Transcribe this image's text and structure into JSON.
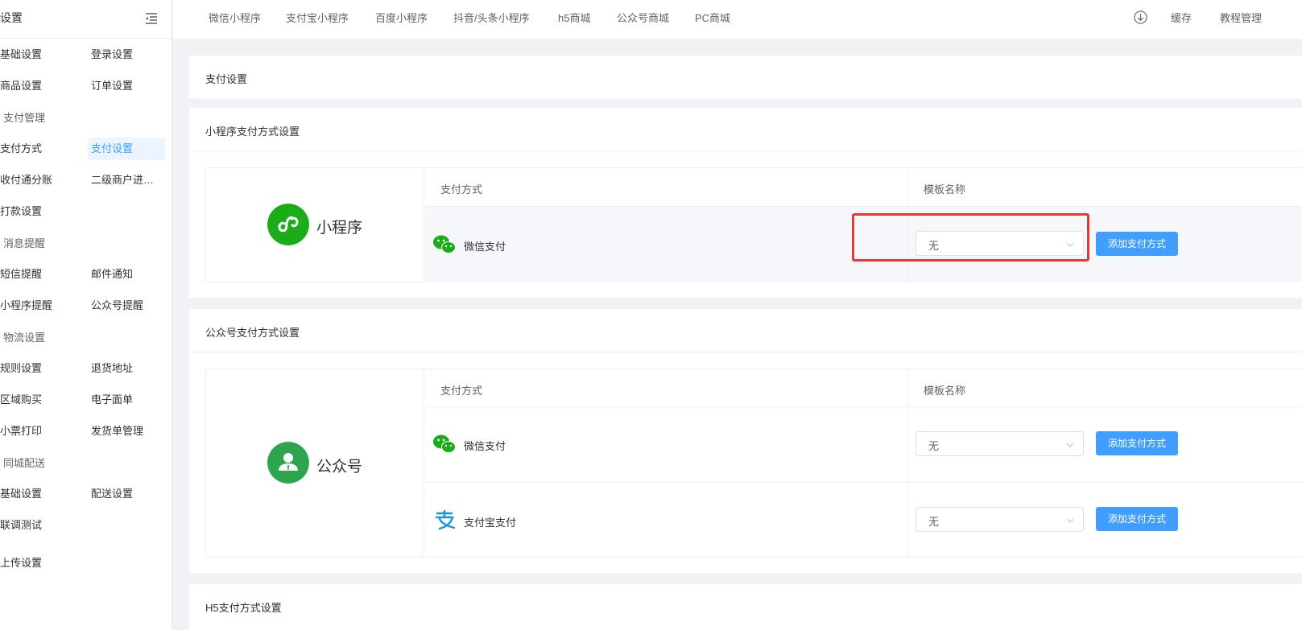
{
  "sidebar": {
    "title": "设置",
    "rows": [
      {
        "left": "基础设置",
        "right": "登录设置"
      },
      {
        "left": "商品设置",
        "right": "订单设置"
      },
      {
        "group": "支付管理"
      },
      {
        "left": "支付方式",
        "right": "支付设置",
        "right_active": true
      },
      {
        "left": "收付通分账",
        "right": "二级商户进…"
      },
      {
        "left": "打款设置"
      },
      {
        "group": "消息提醒"
      },
      {
        "left": "短信提醒",
        "right": "邮件通知"
      },
      {
        "left": "小程序提醒",
        "right": "公众号提醒"
      },
      {
        "group": "物流设置"
      },
      {
        "left": "规则设置",
        "right": "退货地址"
      },
      {
        "left": "区域购买",
        "right": "电子面单"
      },
      {
        "left": "小票打印",
        "right": "发货单管理"
      },
      {
        "group": "同城配送"
      },
      {
        "left": "基础设置",
        "right": "配送设置"
      },
      {
        "left": "联调测试"
      },
      {
        "left": "上传设置"
      }
    ]
  },
  "topbar": {
    "tabs": [
      "微信小程序",
      "支付宝小程序",
      "百度小程序",
      "抖音/头条小程序",
      "h5商城",
      "公众号商城",
      "PC商城"
    ],
    "cache": "缓存",
    "tutorial": "教程管理"
  },
  "page": {
    "title": "支付设置",
    "sections": [
      {
        "title": "小程序支付方式设置",
        "platform": "小程序",
        "col_method": "支付方式",
        "col_template": "模板名称",
        "rows": [
          {
            "icon": "wechat-pay-icon",
            "name": "微信支付",
            "template": "无",
            "button": "添加支付方式"
          }
        ]
      },
      {
        "title": "公众号支付方式设置",
        "platform": "公众号",
        "col_method": "支付方式",
        "col_template": "模板名称",
        "rows": [
          {
            "icon": "wechat-pay-icon",
            "name": "微信支付",
            "template": "无",
            "button": "添加支付方式"
          },
          {
            "icon": "alipay-icon",
            "name": "支付宝支付",
            "template": "无",
            "button": "添加支付方式"
          }
        ]
      },
      {
        "title": "H5支付方式设置"
      }
    ]
  },
  "colors": {
    "primary": "#409eff",
    "miniprogram_green": "#1aad19",
    "official_green": "#2da44e",
    "alipay_blue": "#1296db",
    "highlight_red": "#e53935"
  }
}
